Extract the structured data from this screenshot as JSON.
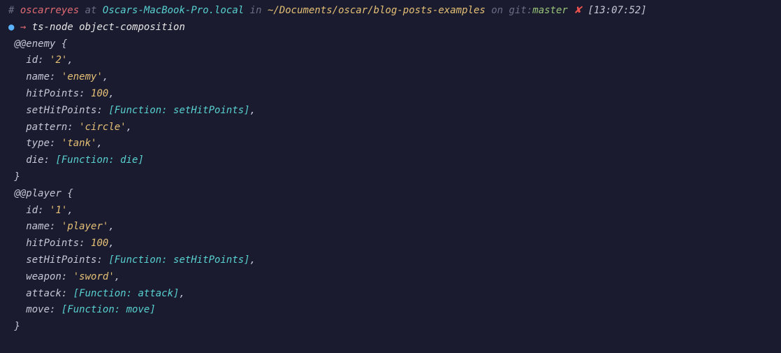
{
  "prompt": {
    "hash": "#",
    "user": "oscarreyes",
    "at": "at",
    "host": "Oscars-MacBook-Pro.local",
    "in": "in",
    "path": "~/Documents/oscar/blog-posts-examples",
    "on": "on",
    "gitLabel": "git:",
    "branch": "master",
    "dirty": "✘",
    "time": "[13:07:52]"
  },
  "command": {
    "bullet": "●",
    "arrow": "→",
    "text": "ts-node object-composition"
  },
  "output": {
    "obj1": {
      "header": "@@enemy {",
      "id": {
        "key": "id:",
        "val": "'2'"
      },
      "name": {
        "key": "name:",
        "val": "'enemy'"
      },
      "hitPoints": {
        "key": "hitPoints:",
        "val": "100"
      },
      "setHitPoints": {
        "key": "setHitPoints:",
        "val": "[Function: setHitPoints]"
      },
      "pattern": {
        "key": "pattern:",
        "val": "'circle'"
      },
      "type": {
        "key": "type:",
        "val": "'tank'"
      },
      "die": {
        "key": "die:",
        "val": "[Function: die]"
      },
      "close": "}"
    },
    "obj2": {
      "header": "@@player {",
      "id": {
        "key": "id:",
        "val": "'1'"
      },
      "name": {
        "key": "name:",
        "val": "'player'"
      },
      "hitPoints": {
        "key": "hitPoints:",
        "val": "100"
      },
      "setHitPoints": {
        "key": "setHitPoints:",
        "val": "[Function: setHitPoints]"
      },
      "weapon": {
        "key": "weapon:",
        "val": "'sword'"
      },
      "attack": {
        "key": "attack:",
        "val": "[Function: attack]"
      },
      "move": {
        "key": "move:",
        "val": "[Function: move]"
      },
      "close": "}"
    }
  },
  "punct": {
    "comma": ",",
    "sp": " ",
    "sp2": "  ",
    "sp3": "   "
  }
}
